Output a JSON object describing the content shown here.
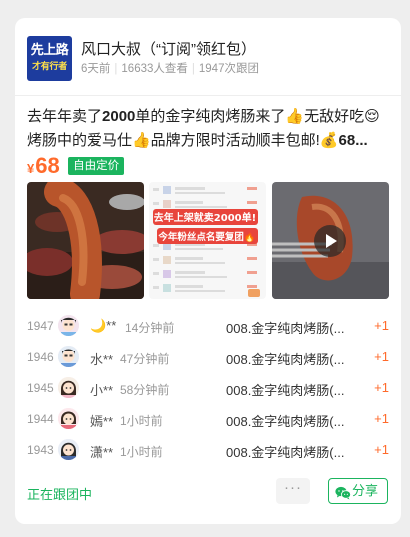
{
  "group": {
    "avatar_line1": "先上路",
    "avatar_line2": "才有行者",
    "name": "风口大叔（“订阅”领红包）",
    "age": "6天前",
    "views": "16633人查看",
    "joins": "1947次跟团"
  },
  "post": {
    "line1_prefix": "去年年卖了",
    "line1_bold": "2000",
    "line1_suffix": "单的金字纯肉烤肠来了👍无敌好吃😌",
    "line2_text": "烤肠中的爱马仕👍品牌方限时活动顺丰包邮!",
    "line2_bold": "💰68..."
  },
  "price": {
    "currency": "¥",
    "value": "68",
    "tag": "自由定价"
  },
  "media": {
    "screenshot_caption1": "去年上架就卖2000单!",
    "screenshot_caption2": "今年粉丝点名要复团🔥"
  },
  "orders": [
    {
      "num": "1947",
      "name": "🌙**",
      "time": "14分钟前",
      "product": "008.金字纯肉烤肠(...",
      "qty": "+1"
    },
    {
      "num": "1946",
      "name": "水**",
      "time": "47分钟前",
      "product": "008.金字纯肉烤肠(...",
      "qty": "+1"
    },
    {
      "num": "1945",
      "name": "小**",
      "time": "58分钟前",
      "product": "008.金字纯肉烤肠(...",
      "qty": "+1"
    },
    {
      "num": "1944",
      "name": "嫣**",
      "time": "1小时前",
      "product": "008.金字纯肉烤肠(...",
      "qty": "+1"
    },
    {
      "num": "1943",
      "name": "潇**",
      "time": "1小时前",
      "product": "008.金字纯肉烤肠(...",
      "qty": "+1"
    }
  ],
  "footer": {
    "status": "正在跟团中",
    "more": "···",
    "share": "分享"
  },
  "colors": {
    "accent_green": "#1bb45e",
    "price_orange": "#ff6a2b"
  }
}
